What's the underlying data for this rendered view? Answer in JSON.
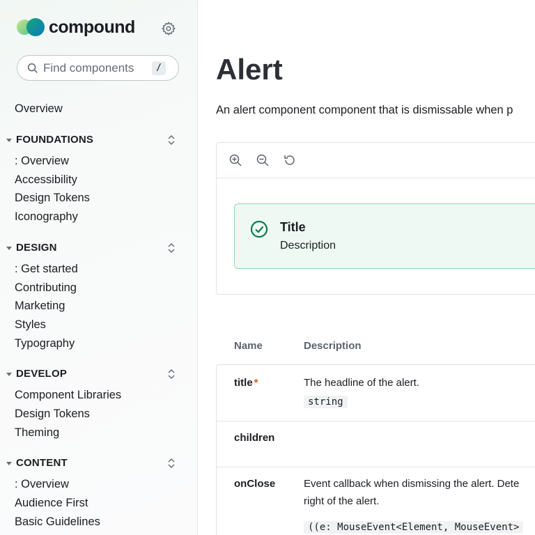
{
  "brand": {
    "name": "compound"
  },
  "search": {
    "placeholder": "Find components",
    "shortcut": "/"
  },
  "nav": {
    "top_item": "Overview",
    "sections": [
      {
        "title": "FOUNDATIONS",
        "items": [
          ": Overview",
          "Accessibility",
          "Design Tokens",
          "Iconography"
        ]
      },
      {
        "title": "DESIGN",
        "items": [
          ": Get started",
          "Contributing",
          "Marketing",
          "Styles",
          "Typography"
        ]
      },
      {
        "title": "DEVELOP",
        "items": [
          "Component Libraries",
          "Design Tokens",
          "Theming"
        ]
      },
      {
        "title": "CONTENT",
        "items": [
          ": Overview",
          "Audience First",
          "Basic Guidelines"
        ]
      }
    ]
  },
  "page": {
    "title": "Alert",
    "lede": "An alert component component that is dismissable when p"
  },
  "preview": {
    "tools": [
      "zoom-in-icon",
      "zoom-out-icon",
      "reset-icon"
    ],
    "alert": {
      "title": "Title",
      "description": "Description",
      "status_color": "#0a7a55"
    }
  },
  "props": {
    "headers": {
      "name": "Name",
      "description": "Description"
    },
    "rows": [
      {
        "name": "title",
        "required": "*",
        "description": "The headline of the alert.",
        "type": "string"
      },
      {
        "name": "children",
        "description": ""
      },
      {
        "name": "onClose",
        "description": "Event callback when dismissing the alert. Dete",
        "description2": "right of the alert.",
        "type": "((e: MouseEvent<Element, MouseEvent>"
      }
    ]
  }
}
